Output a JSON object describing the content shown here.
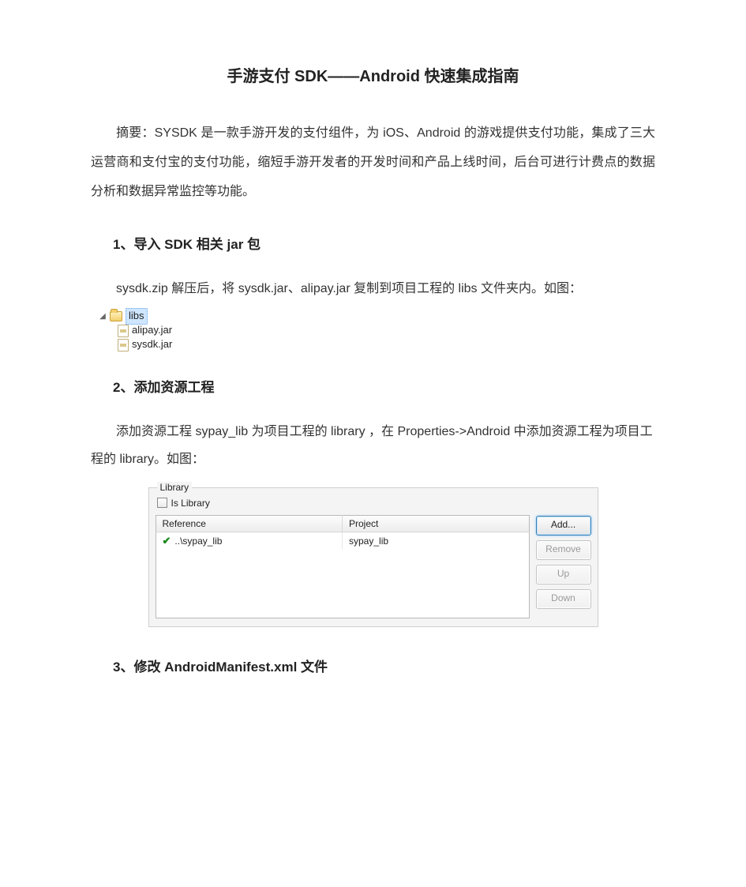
{
  "doc": {
    "title": "手游支付 SDK——Android 快速集成指南",
    "abstract": "摘要：SYSDK 是一款手游开发的支付组件，为 iOS、Android 的游戏提供支付功能，集成了三大运营商和支付宝的支付功能，缩短手游开发者的开发时间和产品上线时间，后台可进行计费点的数据分析和数据异常监控等功能。",
    "section1": {
      "heading": "1、导入 SDK 相关 jar 包",
      "body": "sysdk.zip 解压后，将 sysdk.jar、alipay.jar 复制到项目工程的 libs 文件夹内。如图："
    },
    "tree": {
      "folder": "libs",
      "files": [
        "alipay.jar",
        "sysdk.jar"
      ]
    },
    "section2": {
      "heading": "2、添加资源工程",
      "body": "添加资源工程 sypay_lib 为项目工程的 library ，在 Properties->Android 中添加资源工程为项目工程的 library。如图："
    },
    "library_panel": {
      "legend": "Library",
      "is_library_label": "Is Library",
      "is_library_checked": false,
      "columns": {
        "reference": "Reference",
        "project": "Project"
      },
      "rows": [
        {
          "reference": "..\\sypay_lib",
          "project": "sypay_lib"
        }
      ],
      "buttons": {
        "add": "Add...",
        "remove": "Remove",
        "up": "Up",
        "down": "Down"
      }
    },
    "section3": {
      "heading": "3、修改  AndroidManifest.xml  文件"
    }
  }
}
